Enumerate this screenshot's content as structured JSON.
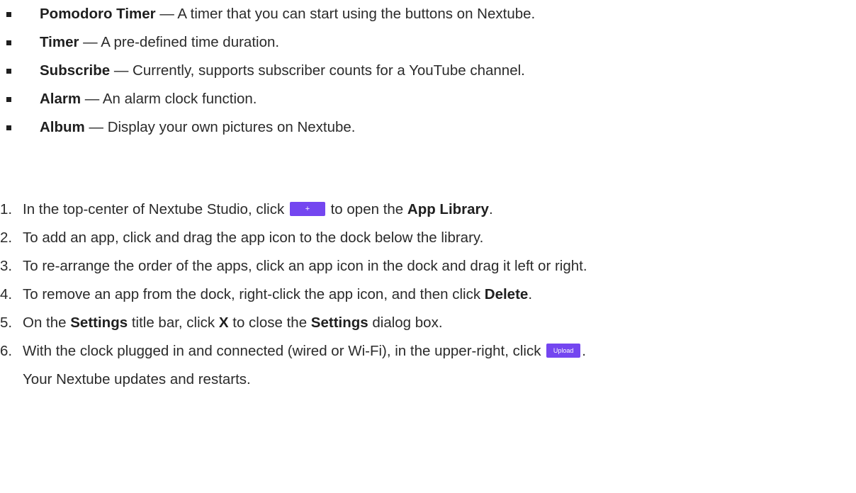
{
  "features": [
    {
      "name": "Pomodoro Timer",
      "sep": " — ",
      "desc": "A timer that you can start using the buttons on Nextube."
    },
    {
      "name": "Timer",
      "sep": " — ",
      "desc": "A pre-defined time duration."
    },
    {
      "name": "Subscribe",
      "sep": " — ",
      "desc": "Currently, supports subscriber counts for a YouTube channel."
    },
    {
      "name": "Alarm",
      "sep": " — ",
      "desc": "An alarm clock function."
    },
    {
      "name": "Album",
      "sep": " — ",
      "desc": "Display your own pictures on Nextube."
    }
  ],
  "steps": {
    "s1": {
      "num": "1.",
      "pre": "In the top-center of Nextube Studio, click ",
      "button": "+",
      "mid": " to open the ",
      "bold": "App Library",
      "post": "."
    },
    "s2": {
      "num": "2.",
      "text": "To add an app, click and drag the app icon to the dock below the library."
    },
    "s3": {
      "num": "3.",
      "text": "To re-arrange the order of the apps, click an app icon in the dock and drag it left or right."
    },
    "s4": {
      "num": "4.",
      "pre": "To remove an app from the dock, right-click the app icon, and then click ",
      "bold": "Delete",
      "post": "."
    },
    "s5": {
      "num": "5.",
      "pre": "On the ",
      "bold1": "Settings",
      "mid1": " title bar, click ",
      "bold2": "X",
      "mid2": " to close the ",
      "bold3": "Settings",
      "post": " dialog box."
    },
    "s6": {
      "num": "6.",
      "pre": "With the clock plugged in and connected (wired or Wi-Fi), in the upper-right, click ",
      "button": "Upload",
      "post": ".",
      "continuation": "Your Nextube updates and restarts."
    }
  },
  "colors": {
    "button_bg": "#7446f0",
    "text": "#2b2b2b"
  }
}
